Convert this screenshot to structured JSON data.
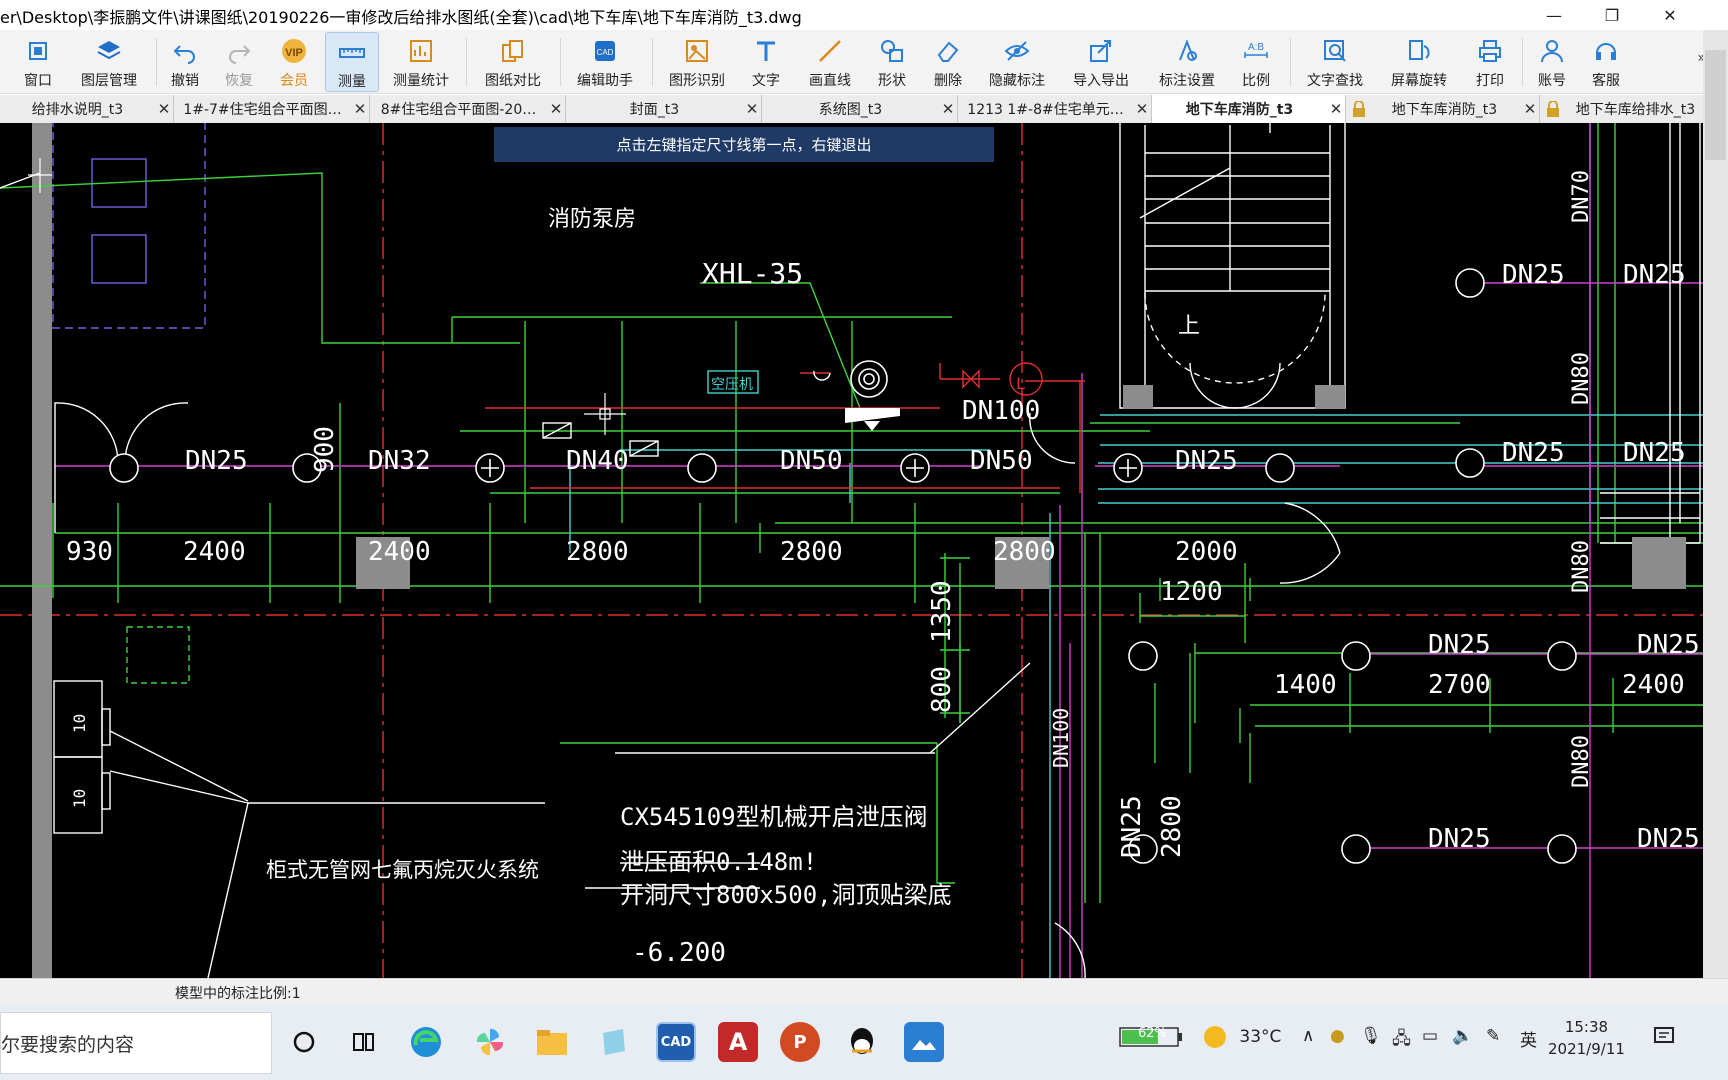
{
  "window": {
    "title": "er\\Desktop\\李振鹏文件\\讲课图纸\\20190226一审修改后给排水图纸(全套)\\cad\\地下车库\\地下车库消防_t3.dwg",
    "minimize": "—",
    "restore": "❐",
    "close": "✕"
  },
  "toolbar": {
    "items": [
      {
        "label": "窗口",
        "icon": "window-icon"
      },
      {
        "label": "图层管理",
        "icon": "layers-icon"
      },
      {
        "label": "撤销",
        "icon": "undo-icon"
      },
      {
        "label": "恢复",
        "icon": "redo-icon"
      },
      {
        "label": "会员",
        "icon": "vip-icon"
      },
      {
        "label": "测量",
        "icon": "measure-icon"
      },
      {
        "label": "测量统计",
        "icon": "measure-stats-icon"
      },
      {
        "label": "图纸对比",
        "icon": "compare-icon"
      },
      {
        "label": "编辑助手",
        "icon": "edit-assistant-icon"
      },
      {
        "label": "图形识别",
        "icon": "shape-recognition-icon"
      },
      {
        "label": "文字",
        "icon": "text-icon"
      },
      {
        "label": "画直线",
        "icon": "line-icon"
      },
      {
        "label": "形状",
        "icon": "shape-icon"
      },
      {
        "label": "删除",
        "icon": "eraser-icon"
      },
      {
        "label": "隐藏标注",
        "icon": "hide-annotation-icon"
      },
      {
        "label": "导入导出",
        "icon": "import-export-icon"
      },
      {
        "label": "标注设置",
        "icon": "annotation-settings-icon"
      },
      {
        "label": "比例",
        "icon": "scale-icon"
      },
      {
        "label": "文字查找",
        "icon": "text-search-icon"
      },
      {
        "label": "屏幕旋转",
        "icon": "rotate-screen-icon"
      },
      {
        "label": "打印",
        "icon": "print-icon"
      },
      {
        "label": "账号",
        "icon": "account-icon"
      },
      {
        "label": "客服",
        "icon": "headset-icon"
      }
    ],
    "vip_badge": "VIP",
    "more": "»"
  },
  "tabs": [
    {
      "label": "给排水说明_t3",
      "close": "✕"
    },
    {
      "label": "1#-7#住宅组合平面图…",
      "close": "✕"
    },
    {
      "label": "8#住宅组合平面图-20…",
      "close": "✕"
    },
    {
      "label": "封面_t3",
      "close": "✕"
    },
    {
      "label": "系统图_t3",
      "close": "✕"
    },
    {
      "label": "1213 1#-8#住宅单元…",
      "close": "✕"
    },
    {
      "label": "地下车库消防_t3",
      "close": "✕",
      "active": true
    },
    {
      "label": "地下车库消防_t3",
      "close": "✕",
      "locked": true
    },
    {
      "label": "地下车库给排水_t3",
      "close": "",
      "locked": true
    }
  ],
  "hint": "点击左键指定尺寸线第一点，右键退出",
  "drawing": {
    "room_label": "消防泵房",
    "equipment_label": "XHL-35",
    "air_compressor": "空压机",
    "pipe_labels": [
      "DN25",
      "DN32",
      "DN40",
      "DN50",
      "DN50",
      "DN25",
      "DN25",
      "DN25",
      "DN25",
      "DN25",
      "DN25",
      "DN25",
      "DN25",
      "DN25"
    ],
    "dn100_top": "DN100",
    "dn100_vertical": "DN100",
    "dn25_vertical": "DN25",
    "dn70": "DN70",
    "dn80_a": "DN80",
    "dn80_b": "DN80",
    "dn80_c": "DN80",
    "dims_row": [
      "930",
      "2400",
      "2400",
      "2800",
      "2800",
      "2800",
      "2000"
    ],
    "dim_900": "900",
    "dim_1200": "1200",
    "dim_1350": "1350",
    "dim_800": "800",
    "dim_1400": "1400",
    "dim_2700": "2700",
    "dim_2400b": "2400",
    "dim_2800v": "2800",
    "valve_title": "CX545109型机械开启泄压阀",
    "valve_area": "泄压面积0.148m!",
    "valve_opening": "开洞尺寸800x500,洞顶贴梁底",
    "elevation": "-6.200",
    "gas_system": "柜式无管网七氟丙烷灭火系统",
    "cabinet_labels": [
      "10",
      "10"
    ],
    "stair_mark": "上",
    "valve_letter": "L"
  },
  "colors": {
    "canvas_bg": "#000000",
    "white_line": "#ffffff",
    "green_line": "#3cd23c",
    "red_line": "#e03030",
    "magenta_line": "#d040d0",
    "cyan_line": "#40d0d0",
    "gray_block": "#8c8c8c",
    "hint_bg": "#1f3a66"
  },
  "statusbar": {
    "scale_text": "模型中的标注比例:1"
  },
  "taskbar": {
    "search_text": "尔要搜索的内容",
    "apps": [
      "cortana-icon",
      "task-view-icon",
      "edge-icon",
      "pinwheel-icon",
      "file-explorer-icon",
      "notes-icon",
      "cad-icon",
      "autocad-icon",
      "powerpoint-icon",
      "qq-icon",
      "photos-icon"
    ],
    "cad_label": "CAD",
    "autocad_label": "A",
    "ppt_label": "P",
    "battery": "62%",
    "weather": "33°C",
    "ime": "英",
    "time": "15:38",
    "date": "2021/9/11"
  }
}
